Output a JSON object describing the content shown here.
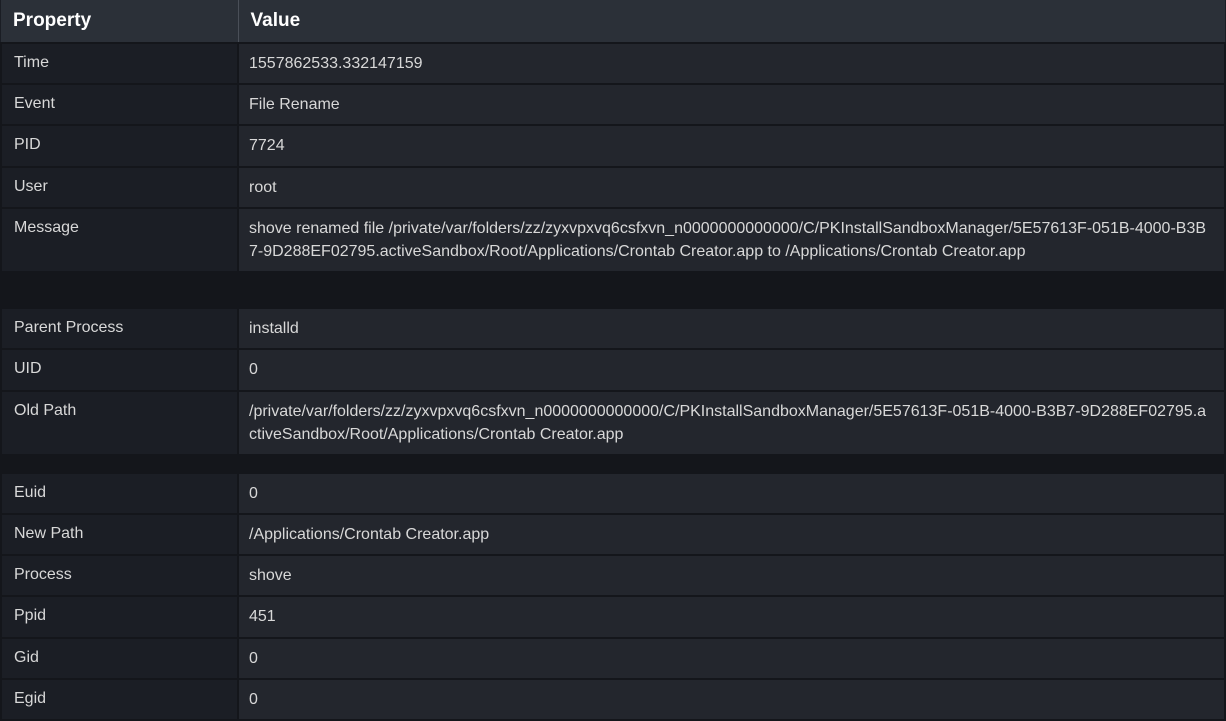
{
  "headers": {
    "property": "Property",
    "value": "Value"
  },
  "rows": [
    {
      "property": "Time",
      "value": "1557862533.332147159"
    },
    {
      "property": "Event",
      "value": "File Rename"
    },
    {
      "property": "PID",
      "value": "7724"
    },
    {
      "property": "User",
      "value": "root"
    },
    {
      "property": "Message",
      "value": "shove renamed file /private/var/folders/zz/zyxvpxvq6csfxvn_n0000000000000/C/PKInstallSandboxManager/5E57613F-051B-4000-B3B7-9D288EF02795.activeSandbox/Root/Applications/Crontab Creator.app to /Applications/Crontab Creator.app"
    },
    {
      "property": "Parent Process",
      "value": "installd"
    },
    {
      "property": "UID",
      "value": "0"
    },
    {
      "property": "Old Path",
      "value": "/private/var/folders/zz/zyxvpxvq6csfxvn_n0000000000000/C/PKInstallSandboxManager/5E57613F-051B-4000-B3B7-9D288EF02795.activeSandbox/Root/Applications/Crontab Creator.app"
    },
    {
      "property": "Euid",
      "value": "0"
    },
    {
      "property": "New Path",
      "value": "/Applications/Crontab Creator.app"
    },
    {
      "property": "Process",
      "value": "shove"
    },
    {
      "property": "Ppid",
      "value": "451"
    },
    {
      "property": "Gid",
      "value": "0"
    },
    {
      "property": "Egid",
      "value": "0"
    }
  ]
}
